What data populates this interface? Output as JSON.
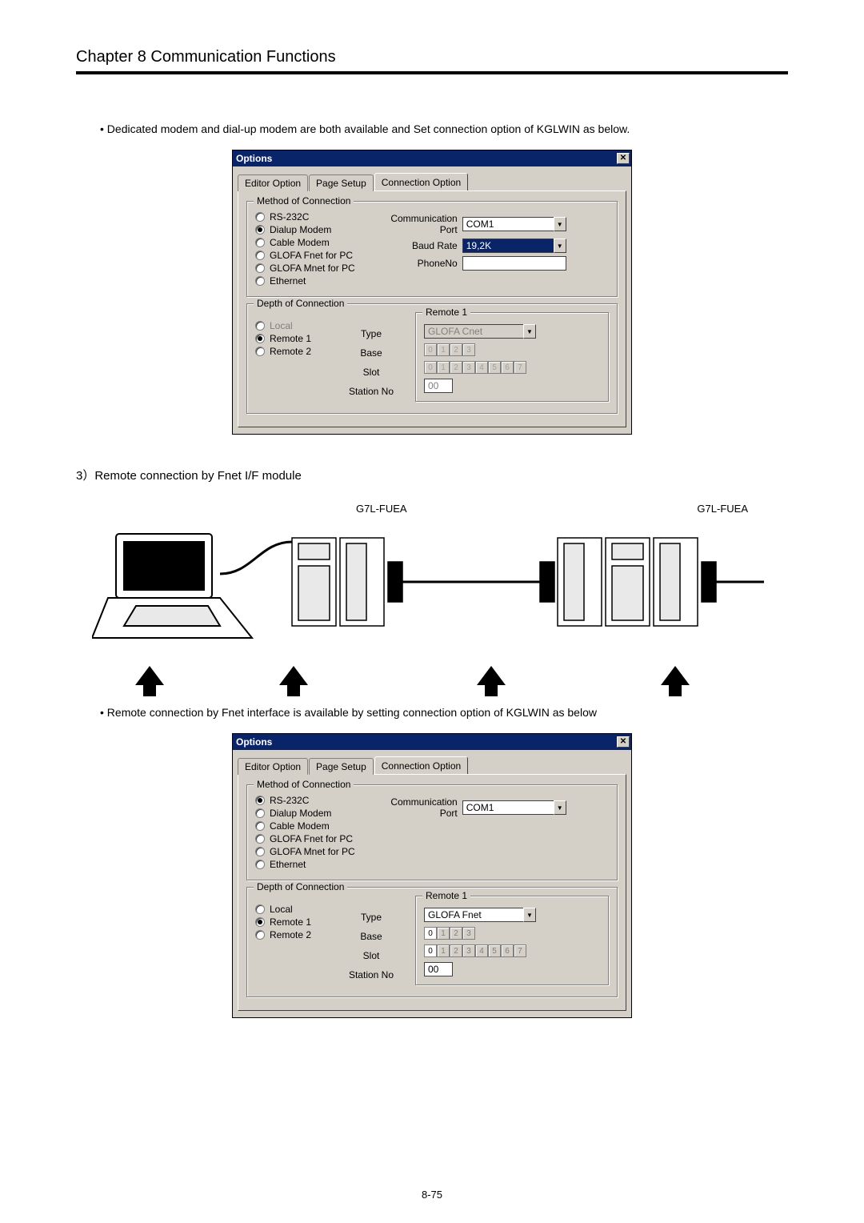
{
  "chapter_title": "Chapter 8    Communication Functions",
  "bullet1": "• Dedicated modem and dial-up modem are both available and Set connection option of KGLWIN as below.",
  "section3_title": "3）Remote connection by Fnet I/F module",
  "diagram_label_left": "G7L-FUEA",
  "diagram_label_right": "G7L-FUEA",
  "bullet2": "• Remote connection by Fnet interface is available by setting connection option of KGLWIN as below",
  "page_number": "8-75",
  "dialog1": {
    "title": "Options",
    "tabs": {
      "t1": "Editor Option",
      "t2": "Page Setup",
      "t3": "Connection Option"
    },
    "method": {
      "legend": "Method of Connection",
      "opts": {
        "rs232c": "RS-232C",
        "dialup": "Dialup Modem",
        "cable": "Cable Modem",
        "fnet": "GLOFA Fnet for PC",
        "mnet": "GLOFA Mnet for PC",
        "eth": "Ethernet"
      },
      "comm_port_label": "Communication Port",
      "comm_port_value": "COM1",
      "baud_label": "Baud Rate",
      "baud_value": "19,2K",
      "phone_label": "PhoneNo"
    },
    "depth": {
      "legend": "Depth of Connection",
      "opts": {
        "local": "Local",
        "remote1": "Remote 1",
        "remote2": "Remote 2"
      },
      "type_label": "Type",
      "base_label": "Base",
      "slot_label": "Slot",
      "station_label": "Station No",
      "remote_legend": "Remote 1",
      "type_value": "GLOFA Cnet",
      "station_value": "00",
      "base_segments": [
        "0",
        "1",
        "2",
        "3"
      ],
      "slot_segments": [
        "0",
        "1",
        "2",
        "3",
        "4",
        "5",
        "6",
        "7"
      ]
    }
  },
  "dialog2": {
    "title": "Options",
    "tabs": {
      "t1": "Editor Option",
      "t2": "Page Setup",
      "t3": "Connection Option"
    },
    "method": {
      "legend": "Method of Connection",
      "opts": {
        "rs232c": "RS-232C",
        "dialup": "Dialup Modem",
        "cable": "Cable Modem",
        "fnet": "GLOFA Fnet for PC",
        "mnet": "GLOFA Mnet for PC",
        "eth": "Ethernet"
      },
      "comm_port_label": "Communication Port",
      "comm_port_value": "COM1"
    },
    "depth": {
      "legend": "Depth of Connection",
      "opts": {
        "local": "Local",
        "remote1": "Remote 1",
        "remote2": "Remote 2"
      },
      "type_label": "Type",
      "base_label": "Base",
      "slot_label": "Slot",
      "station_label": "Station No",
      "remote_legend": "Remote 1",
      "type_value": "GLOFA Fnet",
      "station_value": "00",
      "base_segments": [
        "0",
        "1",
        "2",
        "3"
      ],
      "slot_segments": [
        "0",
        "1",
        "2",
        "3",
        "4",
        "5",
        "6",
        "7"
      ]
    }
  }
}
